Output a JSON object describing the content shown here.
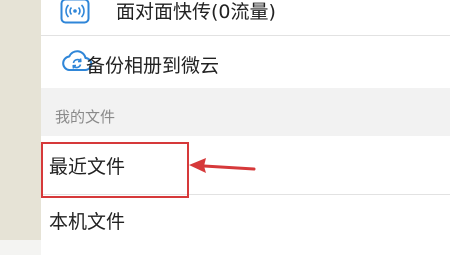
{
  "menu": {
    "items_top": [
      {
        "label": "面对面快传(0流量)",
        "icon": "wifi-signal-icon"
      },
      {
        "label": "备份相册到微云",
        "icon": "cloud-sync-icon"
      }
    ],
    "section_header": "我的文件",
    "items_files": [
      {
        "label": "最近文件",
        "highlighted": true
      },
      {
        "label": "本机文件"
      }
    ]
  },
  "colors": {
    "icon_blue": "#2f86d8",
    "highlight_red": "#d6393a"
  }
}
